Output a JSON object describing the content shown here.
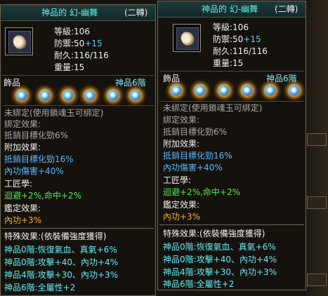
{
  "tooltips": [
    {
      "title": "神品的 幻-幽舞",
      "rebirth": "(二轉)",
      "stats": {
        "level_label": "等級:",
        "level": "106",
        "defense_label": "防禦:",
        "defense": "50",
        "defense_bonus": "+15",
        "durability_label": "耐久:",
        "durability": "116/116",
        "weight_label": "重量:",
        "weight": "15"
      },
      "gem_section_label": "飾品",
      "gem_tier": "神品6階",
      "gem_count": 6,
      "unbound": "未綁定(使用鎖魂玉可綁定)",
      "bind_effect_label": "綁定效果:",
      "bind_effect": "抵銷目標化勁6%",
      "extra_effect_label": "附加效果:",
      "extra_effect_1": "抵銷目標化勁16%",
      "extra_effect_2": "內功傷害+40%",
      "craft_label": "工匠學:",
      "craft_effect": "迴避+2%,命中+2%",
      "appraise_label": "鑑定效果:",
      "appraise_effect": "內功+3%",
      "special_label": "特殊效果:(依裝備強度獲得)",
      "special_1": "神品0階:恢復氣血、真氣+6%",
      "special_2": "神品0階:攻擊+40、內功+4%",
      "special_3": "神品4階:攻擊+30、內功+3%",
      "special_4": "神品6階:全屬性+2"
    },
    {
      "title": "神品的 幻-幽舞",
      "rebirth": "(二轉)",
      "stats": {
        "level_label": "等級:",
        "level": "106",
        "defense_label": "防禦:",
        "defense": "50",
        "defense_bonus": "+15",
        "durability_label": "耐久:",
        "durability": "116/116",
        "weight_label": "重量:",
        "weight": "15"
      },
      "gem_section_label": "飾品",
      "gem_tier": "神品6階",
      "gem_count": 6,
      "unbound": "未綁定(使用鎖魂玉可綁定)",
      "bind_effect_label": "綁定效果:",
      "bind_effect": "抵銷目標化勁6%",
      "extra_effect_label": "附加效果:",
      "extra_effect_1": "抵銷目標化勁16%",
      "extra_effect_2": "內功傷害+40%",
      "craft_label": "工匠學:",
      "craft_effect": "迴避+2%,命中+2%",
      "appraise_label": "鑑定效果:",
      "appraise_effect": "內功+3%",
      "special_label": "特殊效果:(依裝備強度獲得)",
      "special_1": "神品0階:恢復氣血、真氣+6%",
      "special_2": "神品0階:攻擊+40、內功+4%",
      "special_3": "神品4階:攻擊+30、內功+3%",
      "special_4": "神品6階:全屬性+2"
    }
  ],
  "colors": {
    "title": "#5ff0e6",
    "bonus_blue": "#59b8ff",
    "craft_green": "#56e656",
    "appraise_orange": "#f4b12b",
    "special_cyan": "#62e8f3",
    "gem_glow": "#ff9a1a"
  },
  "icons": [
    "robe-item-icon",
    "gem-orb-icon"
  ]
}
